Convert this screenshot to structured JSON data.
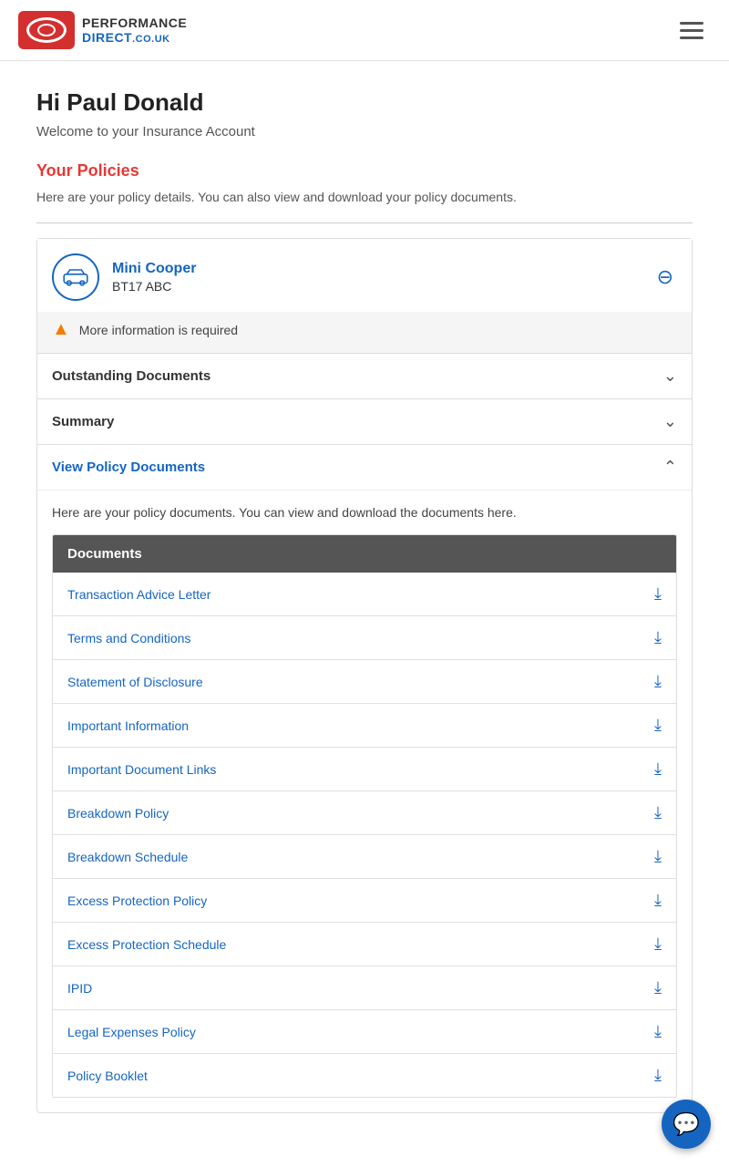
{
  "header": {
    "logo_alt": "Performance Direct Logo",
    "menu_icon": "hamburger-menu"
  },
  "page": {
    "greeting": "Hi Paul Donald",
    "welcome": "Welcome to your Insurance Account",
    "policies_title": "Your Policies",
    "policies_desc": "Here are your policy details. You can also view and download your policy documents."
  },
  "policy_card": {
    "car_name": "Mini Cooper",
    "registration": "BT17 ABC",
    "warning": "More information is required",
    "collapse_icon": "minus-circle"
  },
  "sections": [
    {
      "id": "outstanding-documents",
      "title": "Outstanding Documents",
      "expanded": false
    },
    {
      "id": "summary",
      "title": "Summary",
      "expanded": false
    },
    {
      "id": "view-policy-documents",
      "title": "View Policy Documents",
      "expanded": true,
      "is_blue": true
    }
  ],
  "documents_section": {
    "description": "Here are your policy documents. You can view and download the documents here.",
    "header": "Documents",
    "items": [
      {
        "id": "transaction-advice-letter",
        "name": "Transaction Advice Letter"
      },
      {
        "id": "terms-and-conditions",
        "name": "Terms and Conditions"
      },
      {
        "id": "statement-of-disclosure",
        "name": "Statement of Disclosure"
      },
      {
        "id": "important-information",
        "name": "Important Information"
      },
      {
        "id": "important-document-links",
        "name": "Important Document Links"
      },
      {
        "id": "breakdown-policy",
        "name": "Breakdown Policy"
      },
      {
        "id": "breakdown-schedule",
        "name": "Breakdown Schedule"
      },
      {
        "id": "excess-protection-policy",
        "name": "Excess Protection Policy"
      },
      {
        "id": "excess-protection-schedule",
        "name": "Excess Protection Schedule"
      },
      {
        "id": "ipid",
        "name": "IPID"
      },
      {
        "id": "legal-expenses-policy",
        "name": "Legal Expenses Policy"
      },
      {
        "id": "policy-booklet",
        "name": "Policy Booklet"
      }
    ]
  }
}
